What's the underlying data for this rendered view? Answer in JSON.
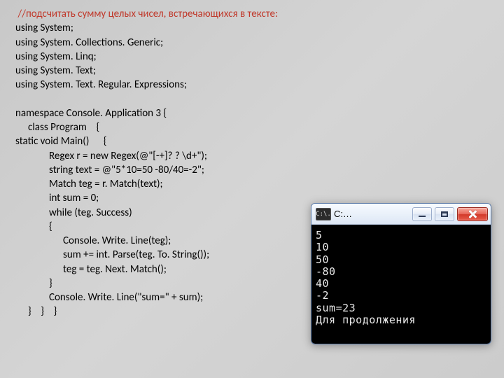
{
  "code": {
    "comment": " //подсчитать сумму целых чисел, встречающихся в тексте:",
    "usings": [
      "using System;",
      "using System. Collections. Generic;",
      "using System. Linq;",
      "using System. Text;",
      "using System. Text. Regular. Expressions;"
    ],
    "blank": "",
    "ns": "namespace Console. Application 3 {",
    "cls": "class Program    {",
    "main": "static void Main()      {",
    "body": [
      "Regex r = new Regex(@\"[-+]? ? \\d+\");",
      "string text = @\"5*10=50 -80/40=-2\";",
      "Match teg = r. Match(text);",
      "int sum = 0;",
      "while (teg. Success)",
      "{"
    ],
    "inner": [
      "Console. Write. Line(teg);",
      "sum += int. Parse(teg. To. String());",
      "teg = teg. Next. Match();"
    ],
    "closeInner": "}",
    "writeSum": "Console. Write. Line(\"sum=\" + sum);",
    "closeAll": "}    }    }"
  },
  "console": {
    "icon": "C:\\.",
    "title": "C:…",
    "lines": [
      "5",
      "10",
      "50",
      "-80",
      "40",
      "-2",
      "sum=23",
      "Для продолжения"
    ]
  }
}
